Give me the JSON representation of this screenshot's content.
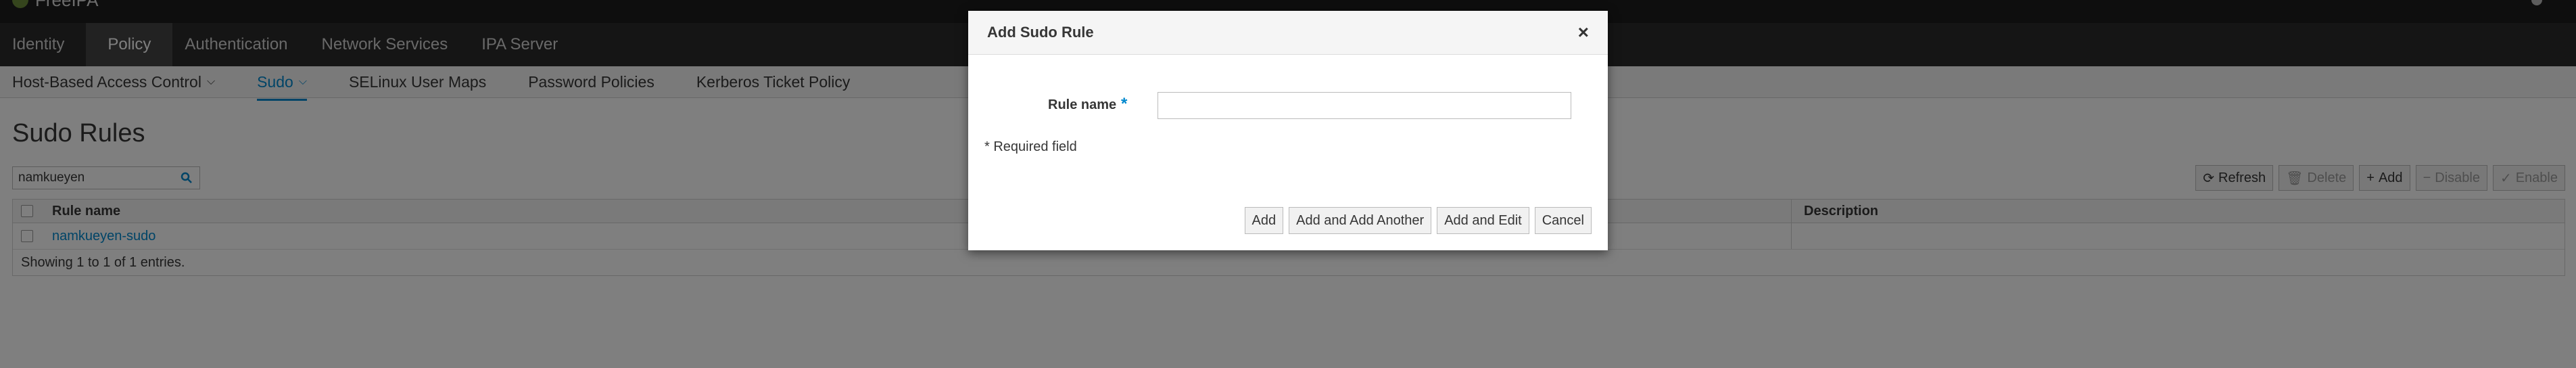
{
  "brand": {
    "name": "FreeIPA"
  },
  "nav_primary": [
    {
      "label": "Identity"
    },
    {
      "label": "Policy"
    },
    {
      "label": "Authentication"
    },
    {
      "label": "Network Services"
    },
    {
      "label": "IPA Server"
    }
  ],
  "nav_secondary": [
    {
      "label": "Host-Based Access Control"
    },
    {
      "label": "Sudo"
    },
    {
      "label": "SELinux User Maps"
    },
    {
      "label": "Password Policies"
    },
    {
      "label": "Kerberos Ticket Policy"
    }
  ],
  "page": {
    "title": "Sudo Rules"
  },
  "search": {
    "value": "namkueyen"
  },
  "toolbar": {
    "refresh": "Refresh",
    "delete": "Delete",
    "add": "Add",
    "disable": "Disable",
    "enable": "Enable"
  },
  "table": {
    "columns": [
      "Rule name",
      "Description"
    ],
    "rows": [
      {
        "rule_name": "namkueyen-sudo",
        "description": ""
      }
    ],
    "footer": "Showing 1 to 1 of 1 entries."
  },
  "modal": {
    "title": "Add Sudo Rule",
    "close": "×",
    "field_label": "Rule name",
    "required_marker": "*",
    "field_value": "",
    "required_note": "* Required field",
    "buttons": {
      "add": "Add",
      "add_another": "Add and Add Another",
      "add_edit": "Add and Edit",
      "cancel": "Cancel"
    }
  },
  "colors": {
    "accent": "#0088ce",
    "topbar": "#1d1d1d",
    "nav": "#2b2b2b"
  }
}
